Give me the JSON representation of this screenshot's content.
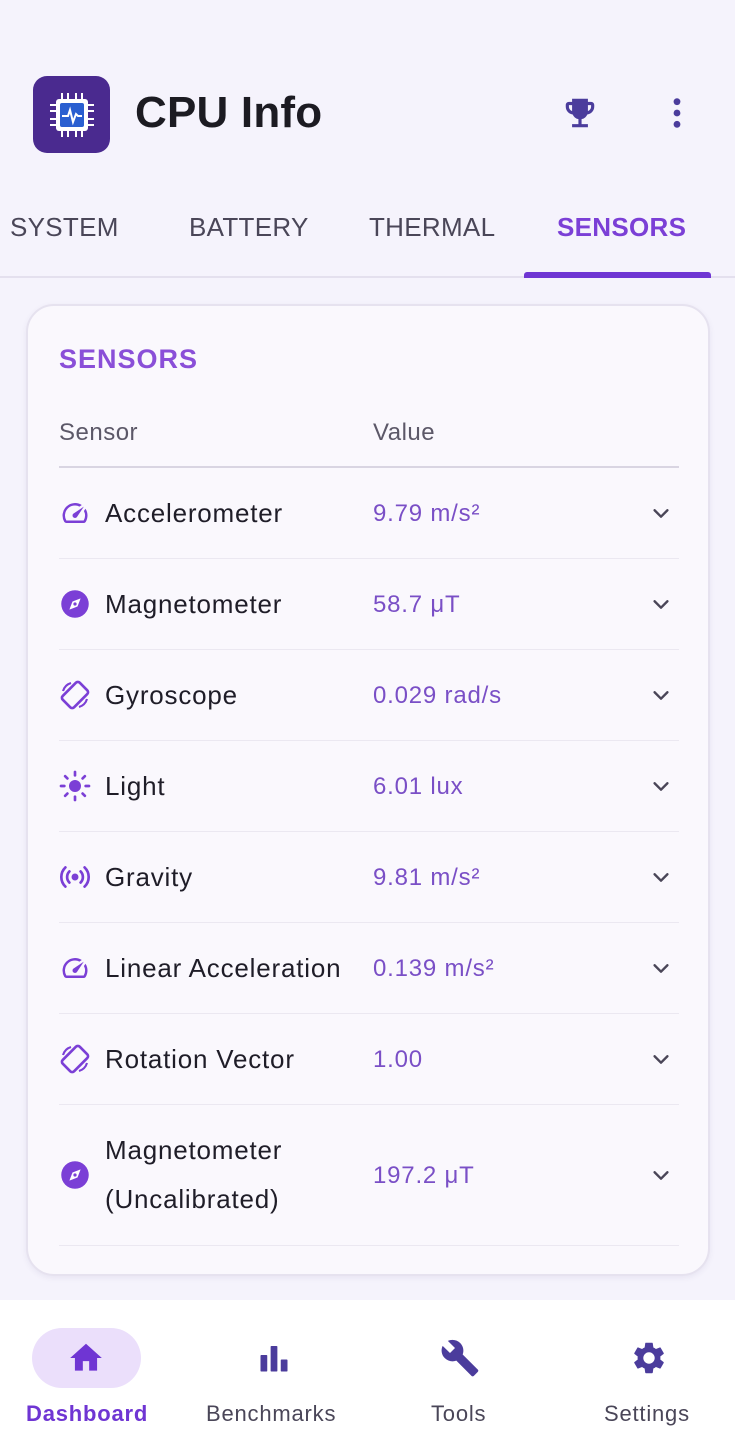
{
  "app": {
    "title": "CPU Info"
  },
  "header": {
    "actions": [
      {
        "icon": "trophy-icon"
      },
      {
        "icon": "more-vert-icon"
      }
    ]
  },
  "tabs": [
    {
      "label": "SYSTEM",
      "active": false
    },
    {
      "label": "BATTERY",
      "active": false
    },
    {
      "label": "THERMAL",
      "active": false
    },
    {
      "label": "SENSORS",
      "active": true
    }
  ],
  "card": {
    "title": "SENSORS",
    "columns": {
      "sensor": "Sensor",
      "value": "Value"
    },
    "rows": [
      {
        "name": "Accelerometer",
        "value": "9.79 m/s²",
        "icon": "speedometer-icon"
      },
      {
        "name": "Magnetometer",
        "value": "58.7 μT",
        "icon": "compass-icon"
      },
      {
        "name": "Gyroscope",
        "value": "0.029 rad/s",
        "icon": "screen-rotation-icon"
      },
      {
        "name": "Light",
        "value": "6.01 lux",
        "icon": "sun-icon"
      },
      {
        "name": "Gravity",
        "value": "9.81 m/s²",
        "icon": "sensors-icon"
      },
      {
        "name": "Linear Acceleration",
        "value": "0.139 m/s²",
        "icon": "speedometer-icon"
      },
      {
        "name": "Rotation Vector",
        "value": "1.00",
        "icon": "screen-rotation-icon"
      },
      {
        "name_line1": "Magnetometer",
        "name_line2": "(Uncalibrated)",
        "value": "197.2 μT",
        "icon": "compass-icon"
      }
    ]
  },
  "bottom_nav": [
    {
      "label": "Dashboard",
      "icon": "home-icon",
      "active": true
    },
    {
      "label": "Benchmarks",
      "icon": "bar-chart-icon",
      "active": false
    },
    {
      "label": "Tools",
      "icon": "wrench-icon",
      "active": false
    },
    {
      "label": "Settings",
      "icon": "gear-icon",
      "active": false
    }
  ],
  "colors": {
    "accent": "#6f35d3",
    "title_accent": "#8a4fd8",
    "value_text": "#7a4fc6",
    "background": "#f5f3fc"
  }
}
